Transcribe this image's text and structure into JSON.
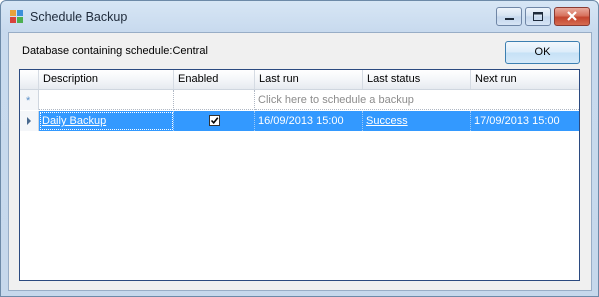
{
  "window": {
    "title": "Schedule Backup"
  },
  "header": {
    "database_label": "Database containing schedule:Central",
    "ok_label": "OK"
  },
  "grid": {
    "columns": [
      "Description",
      "Enabled",
      "Last run",
      "Last status",
      "Next run"
    ],
    "new_row_placeholder": "Click here to schedule a backup",
    "rows": [
      {
        "description": "Daily Backup",
        "enabled": true,
        "last_run": "16/09/2013 15:00",
        "last_status": "Success",
        "next_run": "17/09/2013 15:00"
      }
    ]
  },
  "colors": {
    "selection": "#3399ff",
    "accent": "#2b4a80"
  }
}
